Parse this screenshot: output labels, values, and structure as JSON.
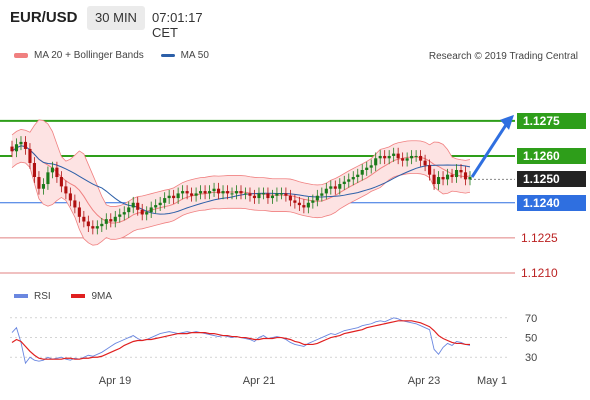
{
  "header": {
    "symbol": "EUR/USD",
    "timeframe": "30 MIN",
    "time": "07:01:17 CET"
  },
  "legend": {
    "bollinger_label": "MA 20 + Bollinger Bands",
    "ma50_label": "MA 50",
    "credit": "Research © 2019 Trading Central",
    "rsi_label": "RSI",
    "ma9_label": "9MA"
  },
  "colors": {
    "bollinger": "#f08080",
    "band_fill": "#fde3e3",
    "ma50": "#2c5fa8",
    "green_level": "#2e9e1a",
    "blue_level": "#2f6fe0",
    "red_level": "#e08080",
    "dark_level": "#222222",
    "rsi": "#6a87e0",
    "ma9": "#e02020",
    "up_candle": "#1a7a1a",
    "down_candle": "#b01010"
  },
  "chart_data": [
    {
      "type": "candlestick",
      "title": "EUR/USD 30 MIN",
      "x_ticks": [
        "Apr 19",
        "Apr 21",
        "Apr 23",
        "May 1"
      ],
      "y_levels": [
        {
          "label": "1.1275",
          "value": 1.1275,
          "style": "green-box"
        },
        {
          "label": "1.1260",
          "value": 1.126,
          "style": "green-box"
        },
        {
          "label": "1.1250",
          "value": 1.125,
          "style": "dark-box"
        },
        {
          "label": "1.1240",
          "value": 1.124,
          "style": "blue-box"
        },
        {
          "label": "1.1225",
          "value": 1.1225,
          "style": "red-text"
        },
        {
          "label": "1.1210",
          "value": 1.121,
          "style": "red-text"
        }
      ],
      "ylim": [
        1.1207,
        1.1301
      ],
      "close": [
        1.1262,
        1.1265,
        1.1266,
        1.1263,
        1.1257,
        1.1251,
        1.1246,
        1.1248,
        1.1253,
        1.1255,
        1.1251,
        1.1247,
        1.1244,
        1.1241,
        1.1238,
        1.1234,
        1.1232,
        1.123,
        1.1229,
        1.123,
        1.1231,
        1.1233,
        1.1232,
        1.1234,
        1.1235,
        1.1236,
        1.1238,
        1.124,
        1.1237,
        1.1235,
        1.1236,
        1.1238,
        1.1239,
        1.124,
        1.1242,
        1.1243,
        1.1242,
        1.1244,
        1.1245,
        1.1244,
        1.1243,
        1.1244,
        1.1245,
        1.1244,
        1.1245,
        1.1246,
        1.1244,
        1.1245,
        1.1244,
        1.1244,
        1.1245,
        1.1244,
        1.1244,
        1.1243,
        1.1242,
        1.1244,
        1.1244,
        1.1242,
        1.1243,
        1.1244,
        1.1244,
        1.1243,
        1.1241,
        1.124,
        1.1239,
        1.1238,
        1.124,
        1.1241,
        1.1243,
        1.1244,
        1.1246,
        1.1247,
        1.1246,
        1.1248,
        1.1249,
        1.125,
        1.1251,
        1.1252,
        1.1254,
        1.1255,
        1.1256,
        1.1259,
        1.126,
        1.1259,
        1.126,
        1.1261,
        1.1259,
        1.1258,
        1.1259,
        1.126,
        1.126,
        1.1258,
        1.1256,
        1.1252,
        1.1248,
        1.1251,
        1.125,
        1.1252,
        1.1251,
        1.1254,
        1.1253,
        1.125,
        1.1251
      ],
      "ma50_endpoints": [
        1.1275,
        1.125
      ],
      "arrow_target": 1.1275
    },
    {
      "type": "line",
      "title": "RSI",
      "y_ticks": [
        30,
        50,
        70
      ],
      "ylim": [
        15,
        80
      ],
      "series": [
        {
          "name": "RSI",
          "values": [
            55,
            60,
            45,
            24,
            30,
            27,
            26,
            27,
            30,
            28,
            29,
            30,
            28,
            27,
            29,
            28,
            30,
            32,
            31,
            33,
            35,
            38,
            41,
            44,
            46,
            48,
            50,
            52,
            49,
            47,
            48,
            50,
            52,
            54,
            55,
            56,
            55,
            54,
            55,
            56,
            55,
            56,
            55,
            54,
            53,
            52,
            51,
            52,
            51,
            50,
            51,
            50,
            49,
            48,
            46,
            50,
            52,
            49,
            50,
            51,
            50,
            48,
            45,
            43,
            42,
            41,
            44,
            46,
            48,
            50,
            52,
            54,
            53,
            55,
            57,
            58,
            59,
            60,
            62,
            63,
            64,
            66,
            67,
            66,
            68,
            70,
            69,
            67,
            66,
            65,
            64,
            62,
            60,
            58,
            38,
            33,
            40,
            44,
            42,
            46,
            45,
            43,
            42
          ]
        },
        {
          "name": "9MA",
          "values": [
            45,
            48,
            46,
            41,
            36,
            32,
            29,
            28,
            28,
            28,
            28,
            28,
            29,
            29,
            28,
            28,
            29,
            29,
            30,
            30,
            31,
            33,
            35,
            37,
            39,
            42,
            44,
            46,
            47,
            47,
            48,
            48,
            49,
            50,
            51,
            52,
            53,
            54,
            54,
            54,
            55,
            55,
            55,
            55,
            54,
            54,
            53,
            52,
            52,
            51,
            51,
            50,
            50,
            49,
            48,
            48,
            49,
            49,
            49,
            50,
            50,
            49,
            48,
            46,
            45,
            43,
            43,
            43,
            44,
            46,
            48,
            50,
            51,
            52,
            54,
            55,
            56,
            57,
            58,
            60,
            61,
            62,
            63,
            64,
            65,
            66,
            67,
            67,
            67,
            67,
            66,
            65,
            63,
            61,
            57,
            52,
            49,
            47,
            45,
            44,
            44,
            43,
            43
          ]
        }
      ]
    }
  ]
}
